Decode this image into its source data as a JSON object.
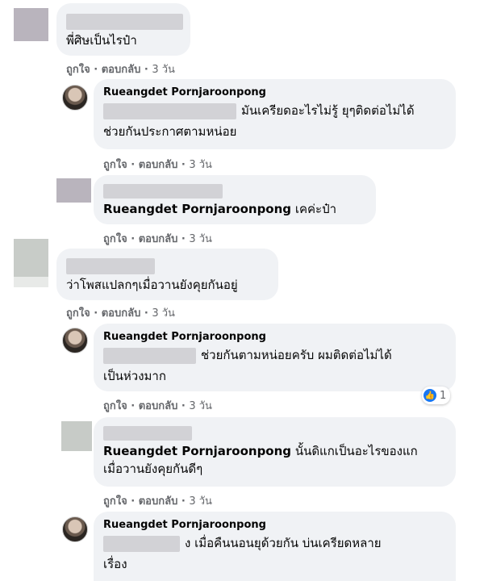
{
  "comments": [
    {
      "text": "พี่ศิษเป็นไรป๋า",
      "actions": {
        "like": "ถูกใจ",
        "reply": "ตอบกลับ",
        "time": "3 วัน"
      }
    },
    {
      "name": "Rueangdet Pornjaroonpong",
      "text": "มันเครียดอะไรไม่รู้ ยุๆติดต่อไม่ได้",
      "text2": "ช่วยกันประกาศตามหน่อย",
      "actions": {
        "like": "ถูกใจ",
        "reply": "ตอบกลับ",
        "time": "3 วัน"
      }
    },
    {
      "mention": "Rueangdet Pornjaroonpong",
      "text": "เคค่ะป๋า",
      "actions": {
        "like": "ถูกใจ",
        "reply": "ตอบกลับ",
        "time": "3 วัน"
      }
    },
    {
      "text": "ว่าโพสแปลกๆเมื่อวานยังคุยกันอยู่",
      "actions": {
        "like": "ถูกใจ",
        "reply": "ตอบกลับ",
        "time": "3 วัน"
      }
    },
    {
      "name": "Rueangdet Pornjaroonpong",
      "text": "ช่วยกันตามหน่อยครับ ผมติดต่อไม่ได้",
      "text2": "เป็นห่วงมาก",
      "actions": {
        "like": "ถูกใจ",
        "reply": "ตอบกลับ",
        "time": "3 วัน"
      },
      "reactions": "1"
    },
    {
      "mention": "Rueangdet Pornjaroonpong",
      "text": "นั้นดิแกเป็นอะไรของแก",
      "text2": "เมื่อวานยังคุยกันดีๆ",
      "actions": {
        "like": "ถูกใจ",
        "reply": "ตอบกลับ",
        "time": "3 วัน"
      }
    },
    {
      "name": "Rueangdet Pornjaroonpong",
      "text": "ง เมื่อคืนนอนยุด้วยกัน บ่นเครียดหลาย",
      "text2": "เรื่อง"
    }
  ],
  "separator": "·",
  "colors": {
    "bubble": "#f0f2f5",
    "secondary_text": "#65676b",
    "like_blue": "#1877f2"
  }
}
